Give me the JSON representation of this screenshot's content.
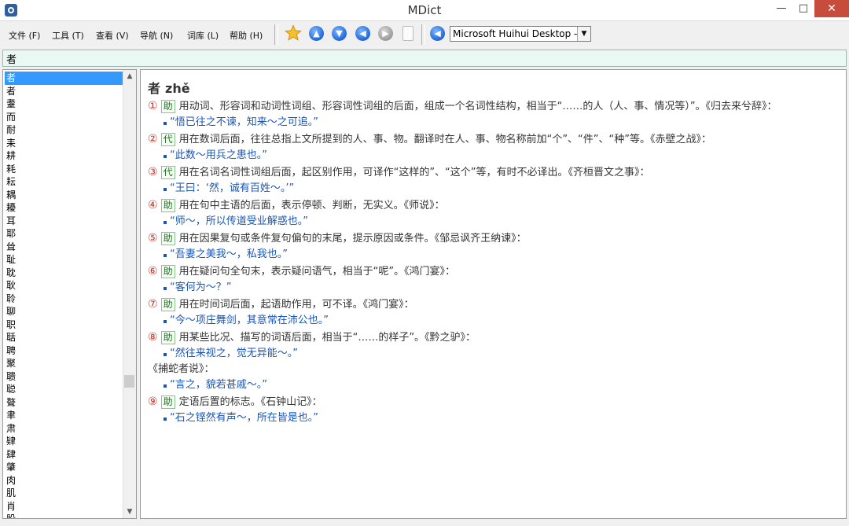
{
  "window": {
    "title": "MDict"
  },
  "menu": [
    "文件 (F)",
    "工具 (T)",
    "查看 (V)",
    "导航 (N)",
    "词库 (L)",
    "帮助 (H)"
  ],
  "toolbar": {
    "dictionary_selected": "Microsoft Huihui Desktop - C"
  },
  "search": {
    "value": "者"
  },
  "word_list": [
    "者",
    "者",
    "耋",
    "而",
    "耐",
    "耒",
    "耕",
    "耗",
    "耘",
    "耦",
    "耰",
    "耳",
    "耶",
    "耸",
    "耻",
    "耽",
    "耿",
    "聆",
    "聊",
    "职",
    "聒",
    "聘",
    "聚",
    "聩",
    "聪",
    "聱",
    "聿",
    "肃",
    "肄",
    "肆",
    "肇",
    "肉",
    "肌",
    "肖",
    "股"
  ],
  "entry": {
    "headword": "者",
    "pinyin": "zhě",
    "senses": [
      {
        "num": "①",
        "pos": "助",
        "text": "用动词、形容词和动词性词组、形容词性词组的后面，组成一个名词性结构，相当于“……的人（人、事、情况等）”。《归去来兮辞》：",
        "examples": [
          "“悟已往之不谏，知来～之可追。”"
        ]
      },
      {
        "num": "②",
        "pos": "代",
        "text": "用在数词后面，往往总指上文所提到的人、事、物。翻译时在人、事、物名称前加“个”、“件”、“种”等。《赤壁之战》：",
        "examples": [
          "“此数～用兵之患也。”"
        ]
      },
      {
        "num": "③",
        "pos": "代",
        "text": "用在名词名词性词组后面，起区别作用，可译作“这样的”、“这个”等，有时不必译出。《齐桓晋文之事》：",
        "examples": [
          "“王曰：‘然，诚有百姓～。’”"
        ]
      },
      {
        "num": "④",
        "pos": "助",
        "text": "用在句中主语的后面，表示停顿、判断，无实义。《师说》：",
        "examples": [
          "“师～，所以传道受业解惑也。”"
        ]
      },
      {
        "num": "⑤",
        "pos": "助",
        "text": "用在因果复句或条件复句偏句的末尾，提示原因或条件。《邹忌讽齐王纳谏》：",
        "examples": [
          "“吾妻之美我～，私我也。”"
        ]
      },
      {
        "num": "⑥",
        "pos": "助",
        "text": "用在疑问句全句末，表示疑问语气，相当于“呢”。《鸿门宴》：",
        "examples": [
          "“客何为～？”"
        ]
      },
      {
        "num": "⑦",
        "pos": "助",
        "text": "用在时间词后面，起语助作用，可不译。《鸿门宴》：",
        "examples": [
          "“今～项庄舞剑，其意常在沛公也。”"
        ]
      },
      {
        "num": "⑧",
        "pos": "助",
        "text": "用某些比况、描写的词语后面，相当于“……的样子”。《黔之驴》：",
        "examples": [
          "“然往来视之，觉无异能～。”"
        ],
        "extra_source": "《捕蛇者说》：",
        "extra_examples": [
          "“言之，貌若甚戚～。”"
        ]
      },
      {
        "num": "⑨",
        "pos": "助",
        "text": "定语后置的标志。《石钟山记》：",
        "examples": [
          "“石之铿然有声～，所在皆是也。”"
        ]
      }
    ]
  }
}
